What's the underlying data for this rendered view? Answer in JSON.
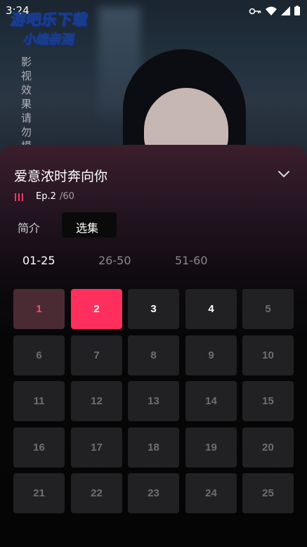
{
  "status_bar": {
    "time": "3:24",
    "icons": [
      "notification-icon",
      "key-icon",
      "wifi-icon",
      "signal-icon",
      "battery-icon"
    ]
  },
  "watermark": {
    "line1": "游吧乐下载",
    "line2": "小编亲测"
  },
  "video": {
    "overlay_text": "影视效果请勿模"
  },
  "sheet": {
    "title": "爱意浓时奔向你",
    "current_episode": "Ep.2",
    "total_episodes": "/60",
    "tabs": [
      {
        "label": "简介",
        "selected": false
      },
      {
        "label": "选集",
        "selected": true
      }
    ],
    "ranges": [
      {
        "label": "01-25",
        "selected": true
      },
      {
        "label": "26-50",
        "selected": false
      },
      {
        "label": "51-60",
        "selected": false
      }
    ],
    "episodes": [
      {
        "label": "1",
        "state": "watched"
      },
      {
        "label": "2",
        "state": "current"
      },
      {
        "label": "3",
        "state": "unlocked"
      },
      {
        "label": "4",
        "state": "unlocked"
      },
      {
        "label": "5",
        "state": "locked"
      },
      {
        "label": "6",
        "state": "locked"
      },
      {
        "label": "7",
        "state": "locked"
      },
      {
        "label": "8",
        "state": "locked"
      },
      {
        "label": "9",
        "state": "locked"
      },
      {
        "label": "10",
        "state": "locked"
      },
      {
        "label": "11",
        "state": "locked"
      },
      {
        "label": "12",
        "state": "locked"
      },
      {
        "label": "13",
        "state": "locked"
      },
      {
        "label": "14",
        "state": "locked"
      },
      {
        "label": "15",
        "state": "locked"
      },
      {
        "label": "16",
        "state": "locked"
      },
      {
        "label": "17",
        "state": "locked"
      },
      {
        "label": "18",
        "state": "locked"
      },
      {
        "label": "19",
        "state": "locked"
      },
      {
        "label": "20",
        "state": "locked"
      },
      {
        "label": "21",
        "state": "locked"
      },
      {
        "label": "22",
        "state": "locked"
      },
      {
        "label": "23",
        "state": "locked"
      },
      {
        "label": "24",
        "state": "locked"
      },
      {
        "label": "25",
        "state": "locked"
      }
    ]
  },
  "colors": {
    "accent": "#fe2f5c",
    "watched_bg": "#4a2b34",
    "cell_bg": "#212123"
  }
}
